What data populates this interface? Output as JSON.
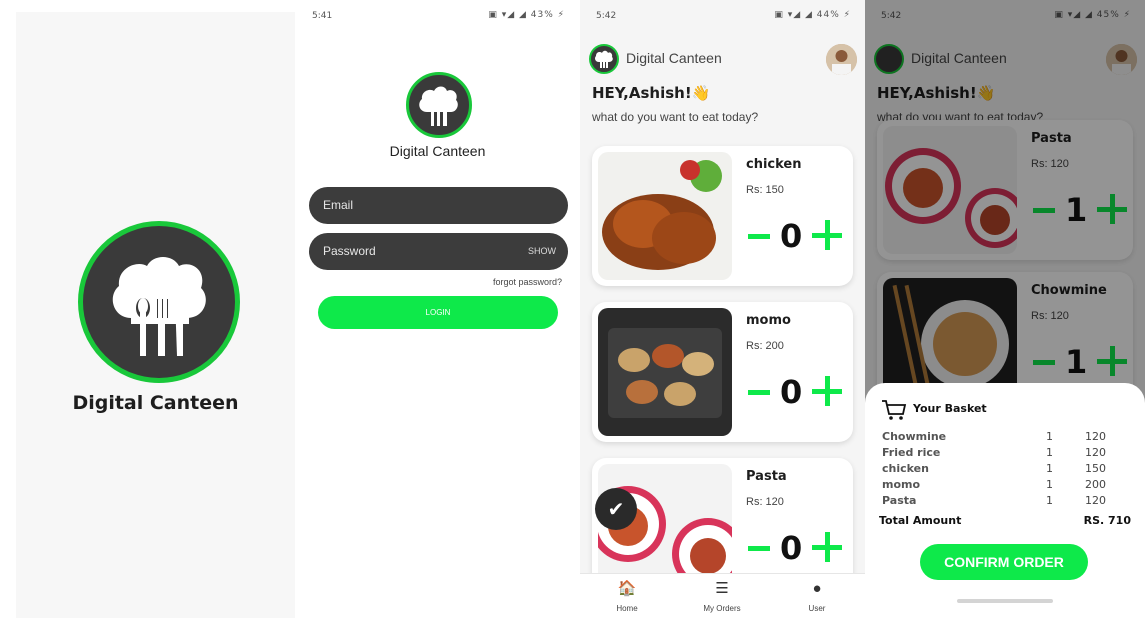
{
  "app": {
    "name": "Digital Canteen",
    "accent": "#0ee94a",
    "ring": "#19c83a"
  },
  "login": {
    "status_time": "5:41",
    "status_icons": "▣ ▾◢ ◢ 43% ⚡",
    "title": "Digital Canteen",
    "email_placeholder": "Email",
    "password_placeholder": "Password",
    "show_label": "SHOW",
    "forgot_label": "forgot password?",
    "login_label": "LOGIN"
  },
  "home": {
    "status_time": "5:42",
    "status_icons": "▣ ▾◢ ◢ 44% ⚡",
    "title": "Digital Canteen",
    "greeting": "HEY,Ashish!👋",
    "subgreeting": "what do you want to eat today?",
    "items": [
      {
        "name": "chicken",
        "price": "Rs:  150",
        "qty": "0"
      },
      {
        "name": "momo",
        "price": "Rs:  200",
        "qty": "0"
      },
      {
        "name": "Pasta",
        "price": "Rs:  120",
        "qty": "0"
      }
    ],
    "nav": [
      {
        "label": "Home",
        "icon": "home-icon"
      },
      {
        "label": "My Orders",
        "icon": "orders-icon"
      },
      {
        "label": "User",
        "icon": "user-icon"
      }
    ]
  },
  "basket_screen": {
    "status_time": "5:42",
    "status_icons": "▣ ▾◢ ◢ 45% ⚡",
    "title": "Digital Canteen",
    "greeting": "HEY,Ashish!👋",
    "subgreeting": "what do you want to eat today?",
    "items": [
      {
        "name": "Pasta",
        "price": "Rs:  120",
        "qty": "1"
      },
      {
        "name": "Chowmine",
        "price": "Rs:  120",
        "qty": "1"
      }
    ],
    "basket": {
      "title": "Your Basket",
      "rows": [
        {
          "name": "Chowmine",
          "qty": "1",
          "price": "120"
        },
        {
          "name": "Fried rice",
          "qty": "1",
          "price": "120"
        },
        {
          "name": "chicken",
          "qty": "1",
          "price": "150"
        },
        {
          "name": "momo",
          "qty": "1",
          "price": "200"
        },
        {
          "name": "Pasta",
          "qty": "1",
          "price": "120"
        }
      ],
      "total_label": "Total Amount",
      "total_value": "RS. 710",
      "confirm_label": "CONFIRM ORDER"
    }
  }
}
